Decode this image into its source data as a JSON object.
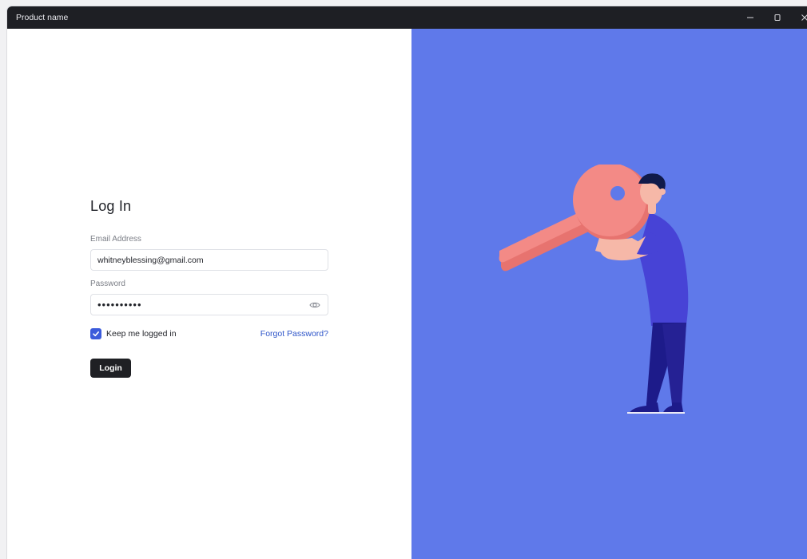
{
  "window": {
    "title": "Product name",
    "controls": [
      "minimize-icon",
      "maximize-icon",
      "close-icon"
    ]
  },
  "login": {
    "heading": "Log In",
    "email_label": "Email Address",
    "email_value": "whitneyblessing@gmail.com",
    "password_label": "Password",
    "password_value": "••••••••••",
    "keep_logged_in_label": "Keep me logged in",
    "keep_logged_in_checked": true,
    "forgot_password_label": "Forgot Password?",
    "login_button_label": "Login"
  },
  "illustration": {
    "description_icon": "person-holding-key-icon"
  },
  "colors": {
    "titlebar": "#1e1f24",
    "accent_panel": "#5f79ea",
    "primary_button": "#1f2024",
    "checkbox": "#3b5bdb",
    "link": "#2f56c9",
    "key": "#f38a86"
  }
}
